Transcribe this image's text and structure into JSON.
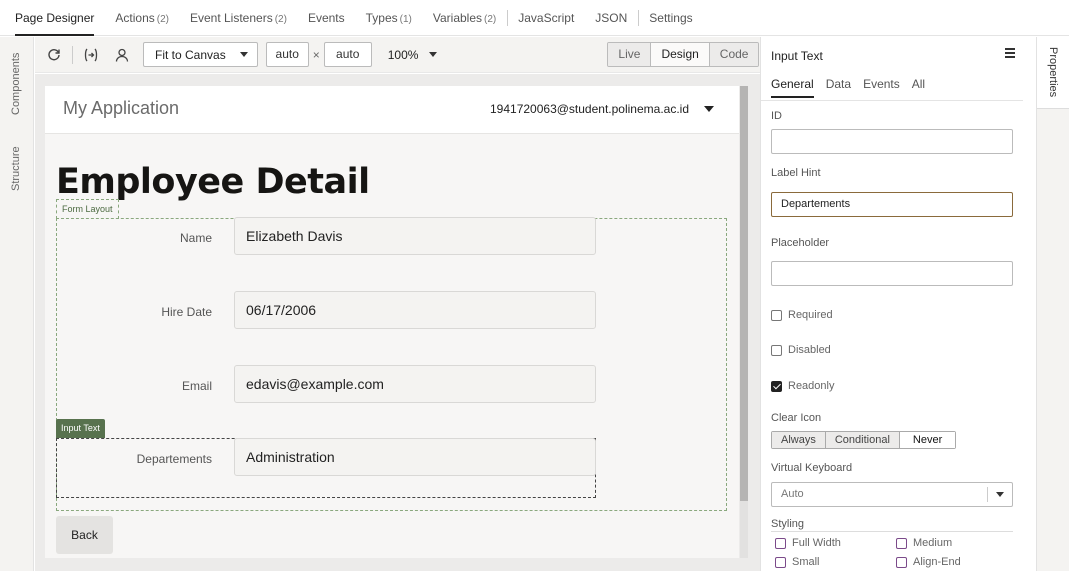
{
  "top_tabs": [
    {
      "label": "Page Designer",
      "count": ""
    },
    {
      "label": "Actions",
      "count": "(2)"
    },
    {
      "label": "Event Listeners",
      "count": "(2)"
    },
    {
      "label": "Events",
      "count": ""
    },
    {
      "label": "Types",
      "count": "(1)"
    },
    {
      "label": "Variables",
      "count": "(2)"
    },
    {
      "label": "JavaScript",
      "count": ""
    },
    {
      "label": "JSON",
      "count": ""
    },
    {
      "label": "Settings",
      "count": ""
    }
  ],
  "left_rail": {
    "components": "Components",
    "structure": "Structure"
  },
  "toolbar": {
    "fit": "Fit to Canvas",
    "width": "auto",
    "times": "×",
    "height": "auto",
    "zoom": "100%",
    "modes": [
      "Live",
      "Design",
      "Code"
    ],
    "active_mode": "Design"
  },
  "app": {
    "title": "My Application",
    "user": "1941720063@student.polinema.ac.id",
    "page_title": "Employee Detail",
    "form_layout_tag": "Form Layout",
    "input_text_tag": "Input Text",
    "fields": [
      {
        "label": "Name",
        "value": "Elizabeth Davis"
      },
      {
        "label": "Hire Date",
        "value": "06/17/2006"
      },
      {
        "label": "Email",
        "value": "edavis@example.com"
      },
      {
        "label": "Departements",
        "value": "Administration"
      }
    ],
    "back": "Back"
  },
  "props": {
    "title": "Input Text",
    "tabs": [
      "General",
      "Data",
      "Events",
      "All"
    ],
    "id_label": "ID",
    "id_value": "",
    "label_hint_label": "Label Hint",
    "label_hint_value": "Departements",
    "placeholder_label": "Placeholder",
    "placeholder_value": "",
    "required": "Required",
    "disabled": "Disabled",
    "readonly": "Readonly",
    "readonly_checked": true,
    "clear_icon_label": "Clear Icon",
    "clear_icon_options": [
      "Always",
      "Conditional",
      "Never"
    ],
    "clear_icon_selected": "Never",
    "virtual_keyboard_label": "Virtual Keyboard",
    "virtual_keyboard_value": "Auto",
    "styling_label": "Styling",
    "styling_options": [
      "Full Width",
      "Medium",
      "Small",
      "Align-End"
    ]
  },
  "right_rail": {
    "properties": "Properties"
  },
  "colors": {
    "accent_dark": "#161513",
    "form_border": "#8aa87e",
    "input_tag_bg": "#58724e",
    "focus_border": "#8a6a3b",
    "styling_checkbox": "#7b4a8a"
  }
}
